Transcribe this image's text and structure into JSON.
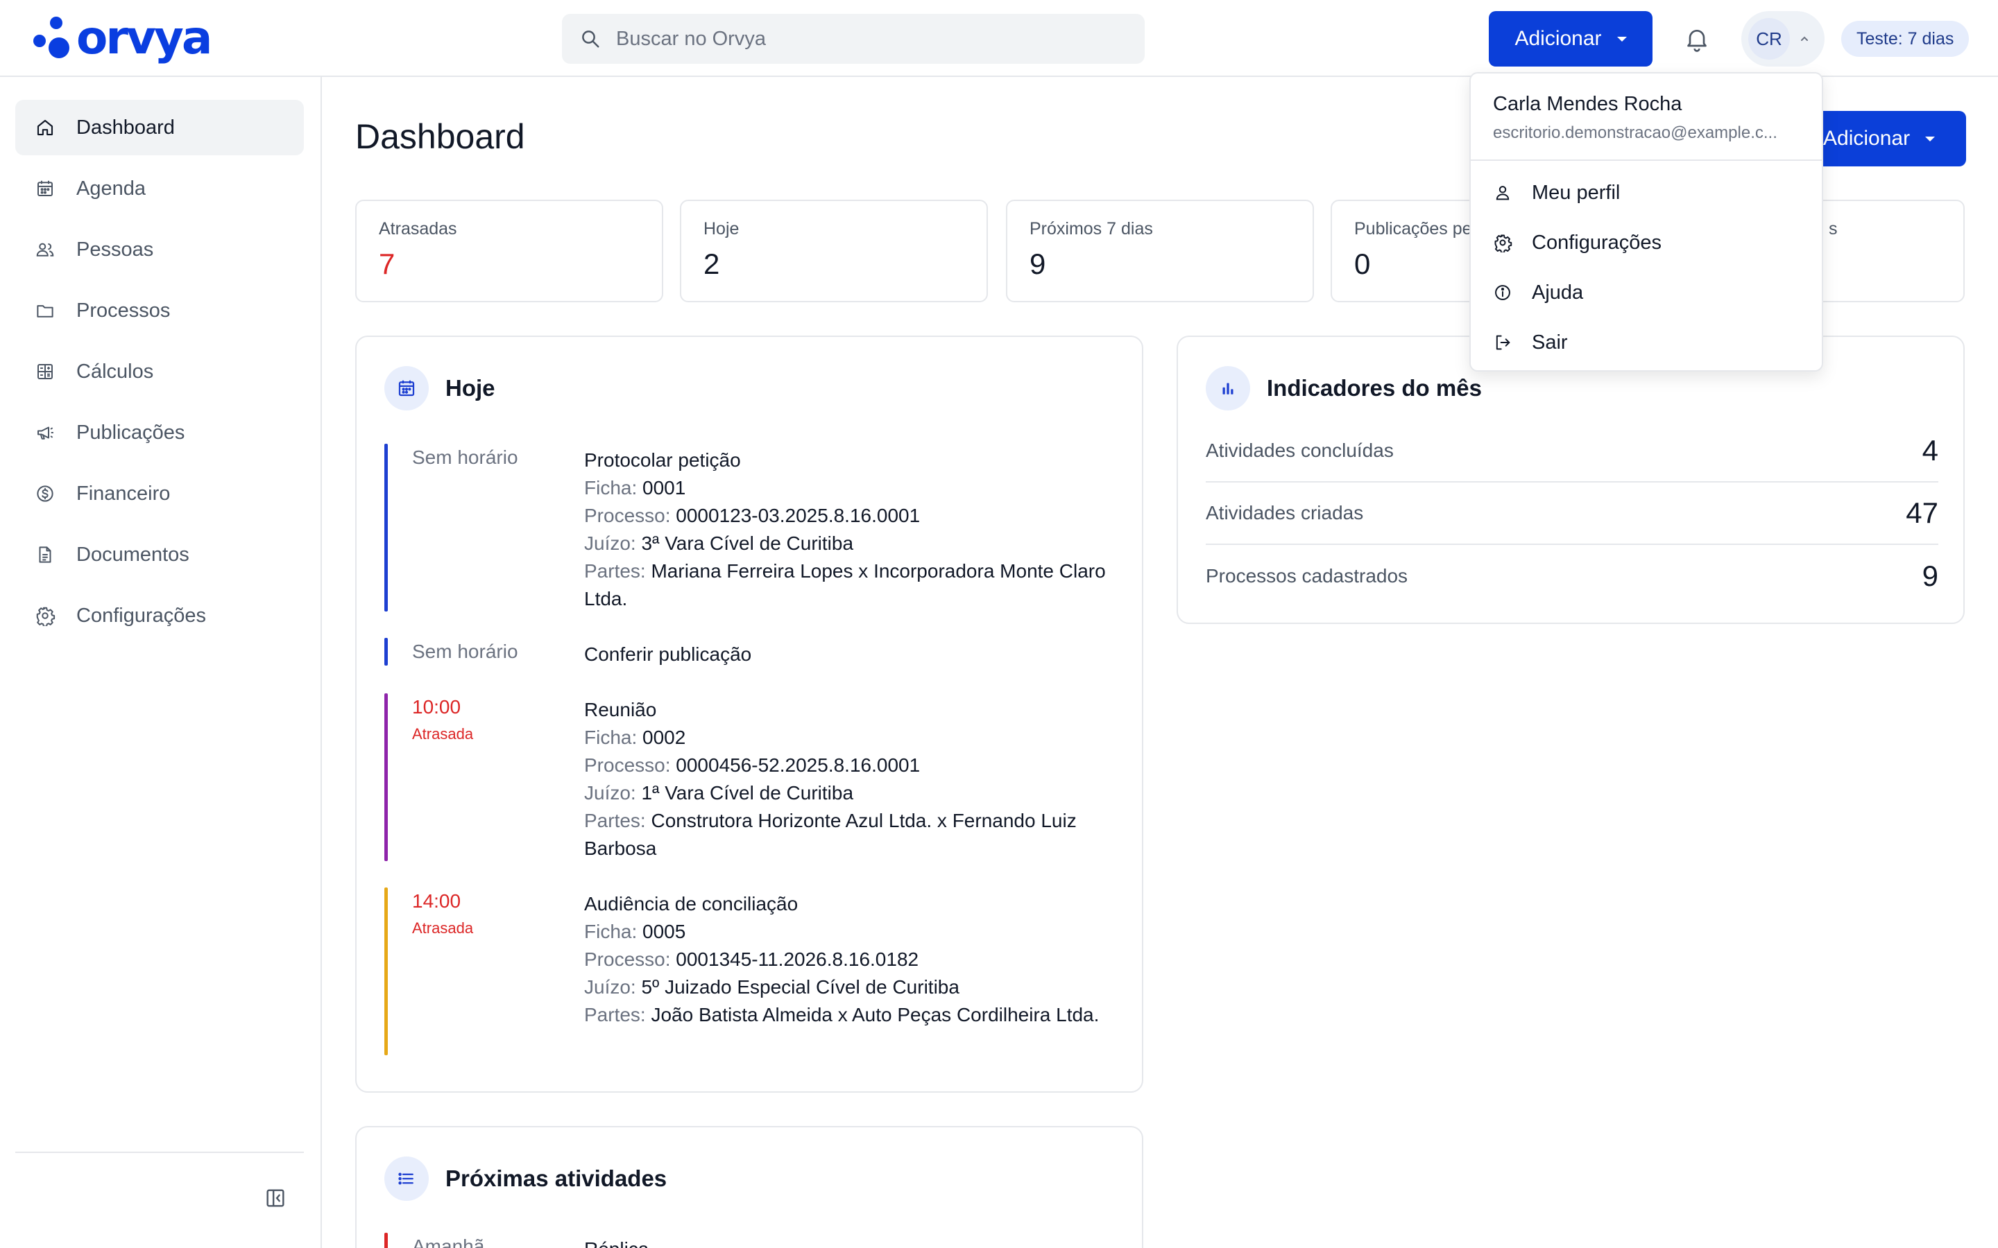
{
  "app": {
    "logo_text": "orvya"
  },
  "topbar": {
    "search_placeholder": "Buscar no Orvya",
    "add_label": "Adicionar",
    "avatar_initials": "CR",
    "trial_label": "Teste: 7 dias",
    "icons": [
      "search-icon",
      "bell-icon",
      "chevron-up-icon"
    ]
  },
  "sidebar": {
    "items": [
      {
        "label": "Dashboard",
        "icon": "home-icon",
        "active": true
      },
      {
        "label": "Agenda",
        "icon": "calendar-icon"
      },
      {
        "label": "Pessoas",
        "icon": "people-icon"
      },
      {
        "label": "Processos",
        "icon": "folder-icon"
      },
      {
        "label": "Cálculos",
        "icon": "calculator-icon"
      },
      {
        "label": "Publicações",
        "icon": "megaphone-icon"
      },
      {
        "label": "Financeiro",
        "icon": "dollar-circle-icon"
      },
      {
        "label": "Documentos",
        "icon": "document-icon"
      },
      {
        "label": "Configurações",
        "icon": "gear-icon"
      }
    ],
    "collapse_icon": "sidebar-collapse-icon"
  },
  "main": {
    "title": "Dashboard",
    "add_label": "Adicionar",
    "stats": [
      {
        "label": "Atrasadas",
        "value": "7",
        "color": "#dc2626"
      },
      {
        "label": "Hoje",
        "value": "2"
      },
      {
        "label": "Próximos 7 dias",
        "value": "9"
      },
      {
        "label": "Publicações pe",
        "value": "0"
      },
      {
        "label": "s",
        "value": ""
      }
    ],
    "today": {
      "title": "Hoje",
      "events": [
        {
          "time": "Sem horário",
          "status": "",
          "bar_color": "#1d3fd1",
          "title": "Protocolar petição",
          "ficha_key": "Ficha:",
          "ficha": "0001",
          "processo_key": "Processo:",
          "processo": "0000123-03.2025.8.16.0001",
          "juizo_key": "Juízo:",
          "juizo": "3ª Vara Cível de Curitiba",
          "partes_key": "Partes:",
          "partes": "Mariana Ferreira Lopes x Incorporadora Monte Claro Ltda."
        },
        {
          "time": "Sem horário",
          "status": "",
          "bar_color": "#1d3fd1",
          "title": "Conferir publicação"
        },
        {
          "time": "10:00",
          "status": "Atrasada",
          "bar_color": "#8e24aa",
          "title": "Reunião",
          "ficha_key": "Ficha:",
          "ficha": "0002",
          "processo_key": "Processo:",
          "processo": "0000456-52.2025.8.16.0001",
          "juizo_key": "Juízo:",
          "juizo": "1ª Vara Cível de Curitiba",
          "partes_key": "Partes:",
          "partes": "Construtora Horizonte Azul Ltda. x Fernando Luiz Barbosa"
        },
        {
          "time": "14:00",
          "status": "Atrasada",
          "bar_color": "#e6a817",
          "title": "Audiência de conciliação",
          "ficha_key": "Ficha:",
          "ficha": "0005",
          "processo_key": "Processo:",
          "processo": "0001345-11.2026.8.16.0182",
          "juizo_key": "Juízo:",
          "juizo": "5º Juizado Especial Cível de Curitiba",
          "partes_key": "Partes:",
          "partes": "João Batista Almeida x Auto Peças Cordilheira Ltda."
        }
      ]
    },
    "upcoming": {
      "title": "Próximas atividades",
      "first_time": "Amanhã",
      "first_title": "Réplica",
      "bar_color": "#dc2626"
    },
    "indicators": {
      "title": "Indicadores do mês",
      "rows": [
        {
          "label": "Atividades concluídas",
          "value": "4"
        },
        {
          "label": "Atividades criadas",
          "value": "47"
        },
        {
          "label": "Processos cadastrados",
          "value": "9"
        }
      ]
    }
  },
  "user_menu": {
    "name": "Carla Mendes Rocha",
    "email": "escritorio.demonstracao@example.c...",
    "items": [
      {
        "label": "Meu perfil",
        "icon": "user-icon"
      },
      {
        "label": "Configurações",
        "icon": "gear-icon"
      },
      {
        "label": "Ajuda",
        "icon": "info-icon"
      },
      {
        "label": "Sair",
        "icon": "logout-icon"
      }
    ]
  },
  "colors": {
    "primary": "#0b3fd9",
    "danger": "#dc2626",
    "border": "#e5e7eb"
  }
}
